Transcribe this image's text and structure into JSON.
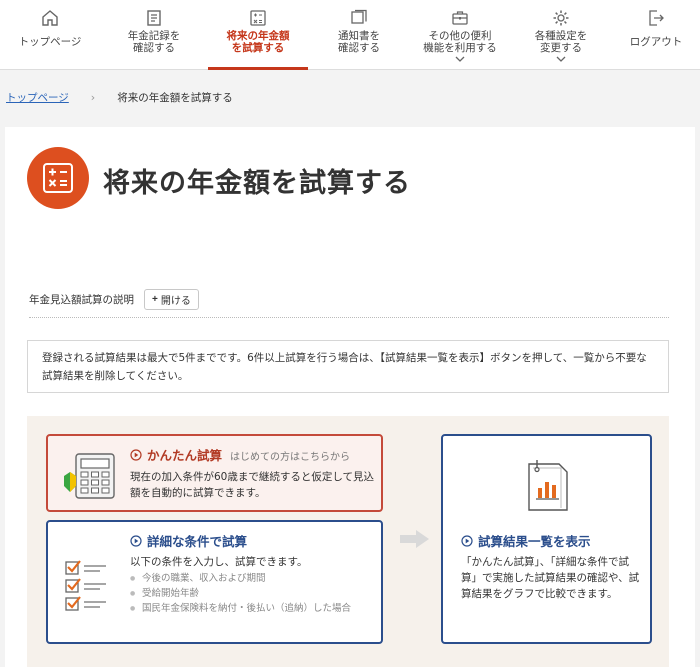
{
  "nav": {
    "items": [
      {
        "label": "トップページ",
        "icon": "home-icon",
        "active": false
      },
      {
        "label": "年金記録を\n確認する",
        "icon": "record-icon",
        "active": false
      },
      {
        "label": "将来の年金額\nを試算する",
        "icon": "calculator-icon",
        "active": true
      },
      {
        "label": "通知書を\n確認する",
        "icon": "documents-icon",
        "active": false
      },
      {
        "label": "その他の便利\n機能を利用する",
        "icon": "briefcase-icon",
        "active": false
      },
      {
        "label": "各種設定を\n変更する",
        "icon": "gear-icon",
        "active": false
      },
      {
        "label": "ログアウト",
        "icon": "logout-icon",
        "active": false
      }
    ]
  },
  "breadcrumb": {
    "home": "トップページ",
    "separator": "›",
    "current": "将来の年金額を試算する"
  },
  "page": {
    "title": "将来の年金額を試算する",
    "explain_label": "年金見込額試算の説明",
    "open_label": "開ける",
    "notice": "登録される試算結果は最大で5件までです。6件以上試算を行う場合は、【試算結果一覧を表示】ボタンを押して、一覧から不要な試算結果を削除してください。"
  },
  "easy": {
    "title": "かんたん試算",
    "subtitle": "はじめての方はこちらから",
    "body": "現在の加入条件が60歳まで継続すると仮定して見込額を自動的に試算できます。"
  },
  "detail": {
    "title": "詳細な条件で試算",
    "body": "以下の条件を入力し、試算できます。",
    "bullets": [
      "今後の職業、収入および期間",
      "受給開始年齢",
      "国民年金保険料を納付・後払い（追納）した場合"
    ]
  },
  "list": {
    "title": "試算結果一覧を表示",
    "body": "「かんたん試算」、「詳細な条件で試算」で実施した試算結果の確認や、試算結果をグラフで比較できます。"
  },
  "colors": {
    "accent": "#c5371b",
    "title_icon_bg": "#dd4f1f",
    "navy": "#2b4e8c",
    "panel_bg": "#f6f1eb"
  }
}
